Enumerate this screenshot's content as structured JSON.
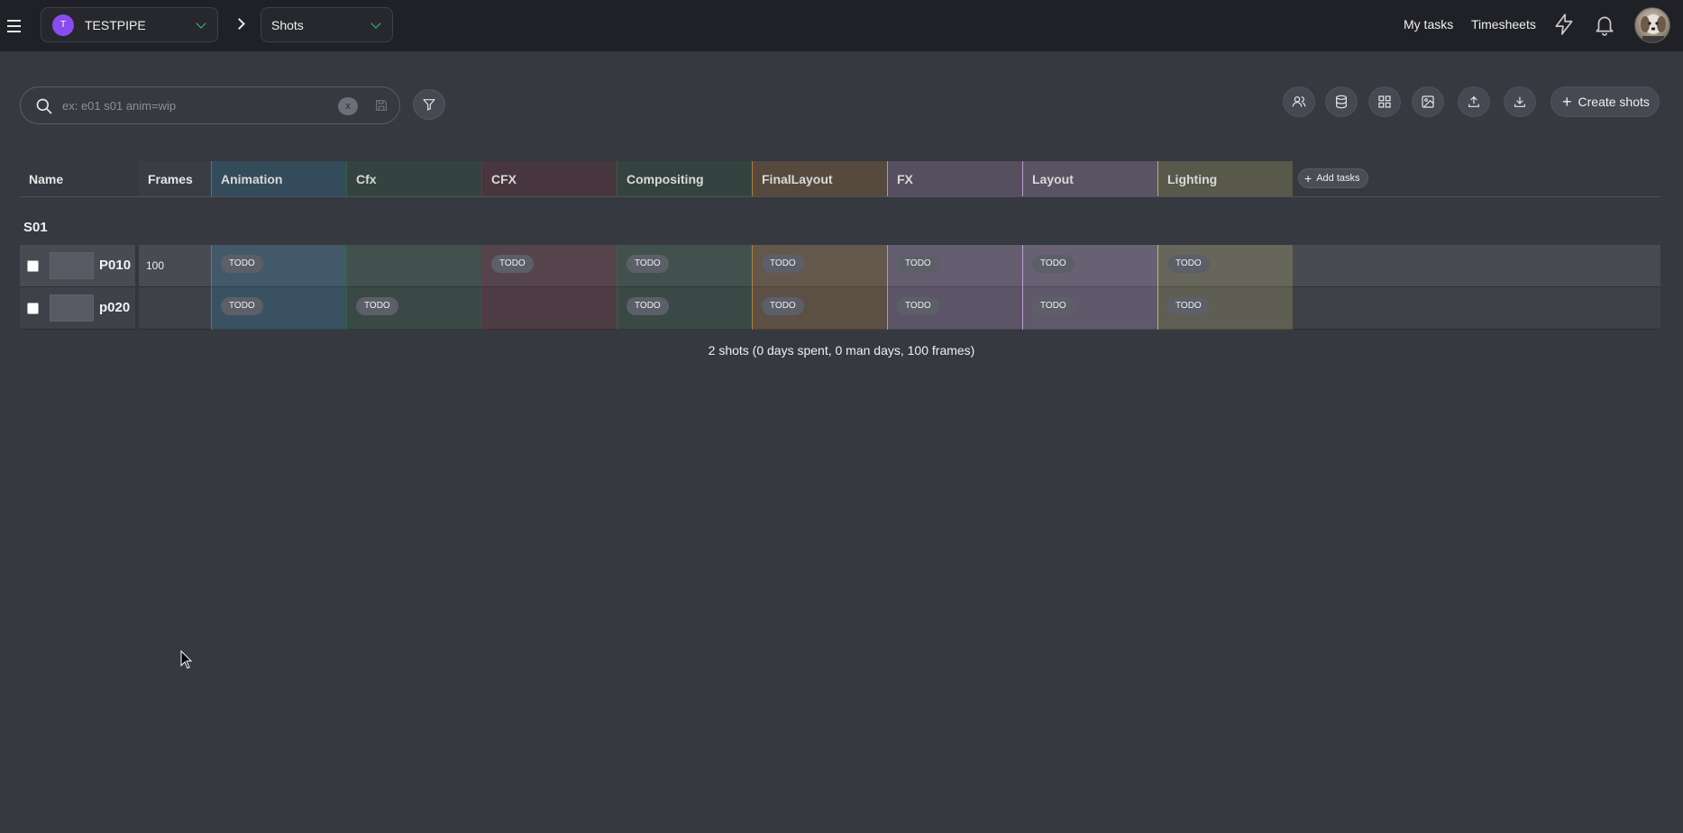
{
  "header": {
    "project": {
      "initial": "T",
      "name": "TESTPIPE"
    },
    "view": "Shots",
    "links": {
      "my_tasks": "My tasks",
      "timesheets": "Timesheets"
    }
  },
  "search": {
    "placeholder": "ex: e01 s01 anim=wip",
    "value": "",
    "clear_label": "x"
  },
  "toolbar": {
    "create_label": "Create shots"
  },
  "table": {
    "name_header": "Name",
    "frames_header": "Frames",
    "add_tasks_label": "Add tasks",
    "task_columns": [
      {
        "label": "Animation",
        "color": "#2e8fc0"
      },
      {
        "label": "Cfx",
        "color": "#2e6b3e"
      },
      {
        "label": "CFX",
        "color": "#8a2c3c"
      },
      {
        "label": "Compositing",
        "color": "#2e6b3e"
      },
      {
        "label": "FinalLayout",
        "color": "#c88a3a"
      },
      {
        "label": "FX",
        "color": "#c9a0d8"
      },
      {
        "label": "Layout",
        "color": "#d6b2e8"
      },
      {
        "label": "Lighting",
        "color": "#d2c878"
      }
    ],
    "group": "S01",
    "rows": [
      {
        "name": "P010",
        "frames": "100",
        "tasks": [
          "TODO",
          "",
          "TODO",
          "TODO",
          "TODO",
          "TODO",
          "TODO",
          "TODO"
        ]
      },
      {
        "name": "p020",
        "frames": "",
        "tasks": [
          "TODO",
          "TODO",
          "",
          "TODO",
          "TODO",
          "TODO",
          "TODO",
          "TODO"
        ]
      }
    ]
  },
  "summary": "2 shots (0 days spent, 0 man days, 100 frames)"
}
